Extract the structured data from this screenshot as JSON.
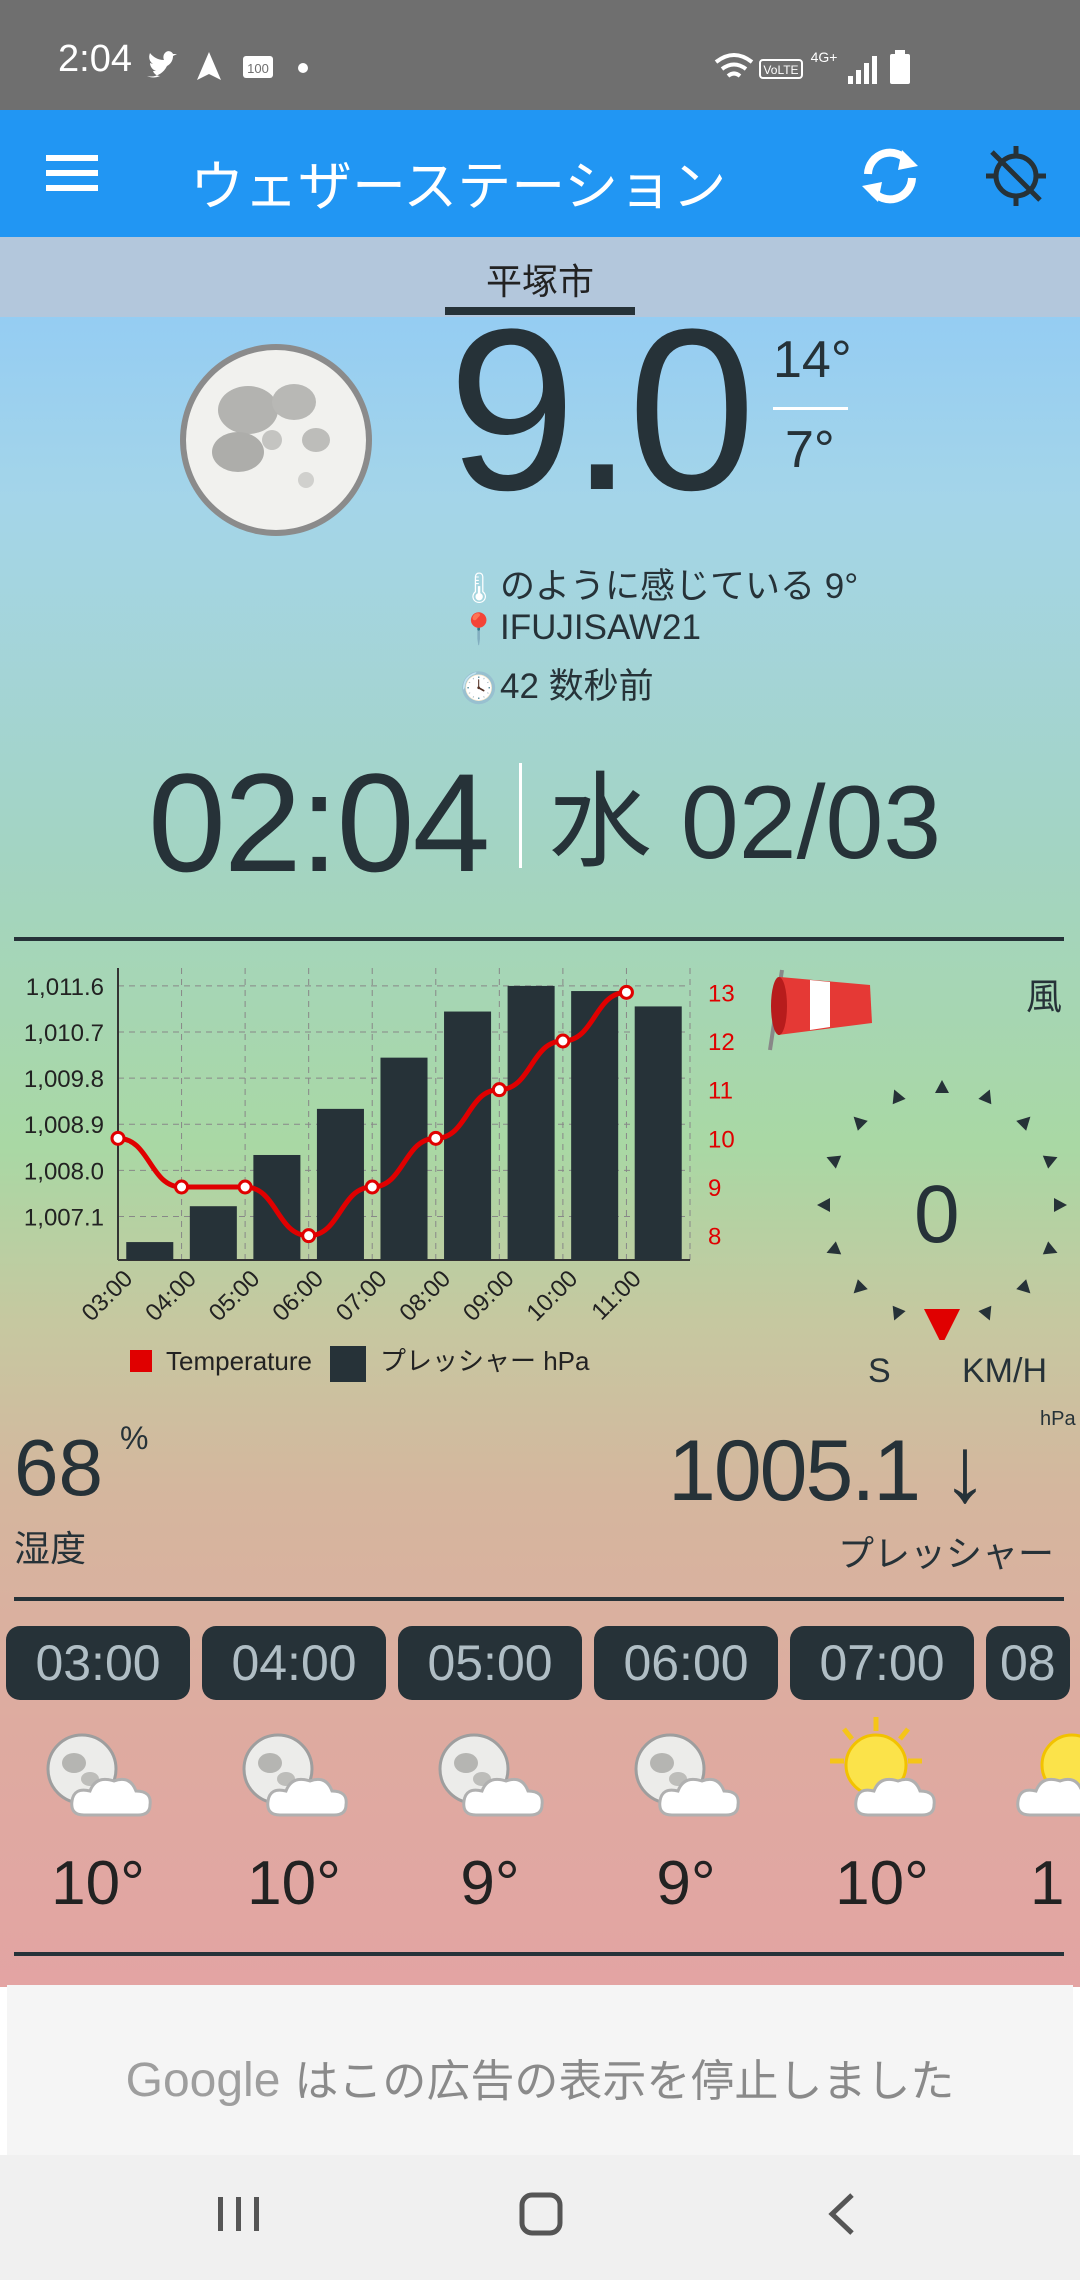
{
  "status_bar": {
    "time": "2:04",
    "left_icons": [
      "twitter-icon",
      "navigation-icon",
      "badge-icon",
      "dot-icon"
    ],
    "left_badge": "100",
    "right_icons": [
      "wifi-icon",
      "volte-icon",
      "signal-icon",
      "battery-icon"
    ],
    "volte": "VoLTE",
    "network": "4G+"
  },
  "app_bar": {
    "title": "ウェザーステーション",
    "icons": [
      "menu-icon",
      "refresh-icon",
      "location-off-icon"
    ]
  },
  "city": "平塚市",
  "current": {
    "temp": "9.0",
    "high": "14°",
    "low": "7°",
    "icon": "full-moon-icon",
    "feels_like": "のように感じている 9°",
    "station": "IFUJISAW21",
    "updated": "42 数秒前"
  },
  "clock": {
    "time": "02:04",
    "date": "水 02/03"
  },
  "chart_data": {
    "type": "bar",
    "categories": [
      "03:00",
      "04:00",
      "05:00",
      "06:00",
      "07:00",
      "08:00",
      "09:00",
      "10:00",
      "11:00"
    ],
    "series": [
      {
        "name": "プレッシャー hPa",
        "type": "bar",
        "axis": "left",
        "color": "#263238",
        "values": [
          1006.6,
          1007.3,
          1008.3,
          1009.2,
          1010.2,
          1011.1,
          1011.6,
          1011.5,
          1011.2
        ]
      },
      {
        "name": "Temperature",
        "type": "line",
        "axis": "right",
        "color": "#e00000",
        "values": [
          10,
          9,
          9,
          8,
          9,
          10,
          11,
          12,
          13
        ]
      }
    ],
    "y_left_ticks": [
      "1,011.6",
      "1,010.7",
      "1,009.8",
      "1,008.9",
      "1,008.0",
      "1,007.1"
    ],
    "y_left_tick_values": [
      1011.6,
      1010.7,
      1009.8,
      1008.9,
      1008.0,
      1007.1
    ],
    "ylim_left": [
      1006.25,
      1011.95
    ],
    "y_right_ticks": [
      "13",
      "12",
      "11",
      "10",
      "9",
      "8"
    ],
    "y_right_tick_values": [
      13,
      12,
      11,
      10,
      9,
      8
    ],
    "ylim_right": [
      7.5,
      13.5
    ],
    "right_axis_color": "#e00000",
    "grid": true,
    "legend_position": "bottom",
    "legend": [
      "Temperature",
      "プレッシャー hPa"
    ]
  },
  "wind": {
    "label": "風",
    "speed": "0",
    "direction": "S",
    "unit": "KM/H",
    "icon": "windsock-icon",
    "pointer_color": "#e00000"
  },
  "humidity": {
    "value": "68",
    "unit": "%",
    "label": "湿度"
  },
  "pressure": {
    "value": "1005.1",
    "trend": "↓",
    "unit": "hPa",
    "label": "プレッシャー"
  },
  "hourly": [
    {
      "time": "03:00",
      "temp": "10°",
      "icon": "moon-cloud-icon"
    },
    {
      "time": "04:00",
      "temp": "10°",
      "icon": "moon-cloud-icon"
    },
    {
      "time": "05:00",
      "temp": "9°",
      "icon": "moon-cloud-icon"
    },
    {
      "time": "06:00",
      "temp": "9°",
      "icon": "moon-cloud-icon"
    },
    {
      "time": "07:00",
      "temp": "10°",
      "icon": "sun-cloud-icon"
    },
    {
      "time": "08",
      "temp": "1",
      "icon": "sun-cloud-icon"
    }
  ],
  "ad": {
    "brand": "Google",
    "text": "はこの広告の表示を停止しました"
  },
  "nav_bar": {
    "icons": [
      "recent-apps-icon",
      "home-icon",
      "back-icon"
    ]
  }
}
